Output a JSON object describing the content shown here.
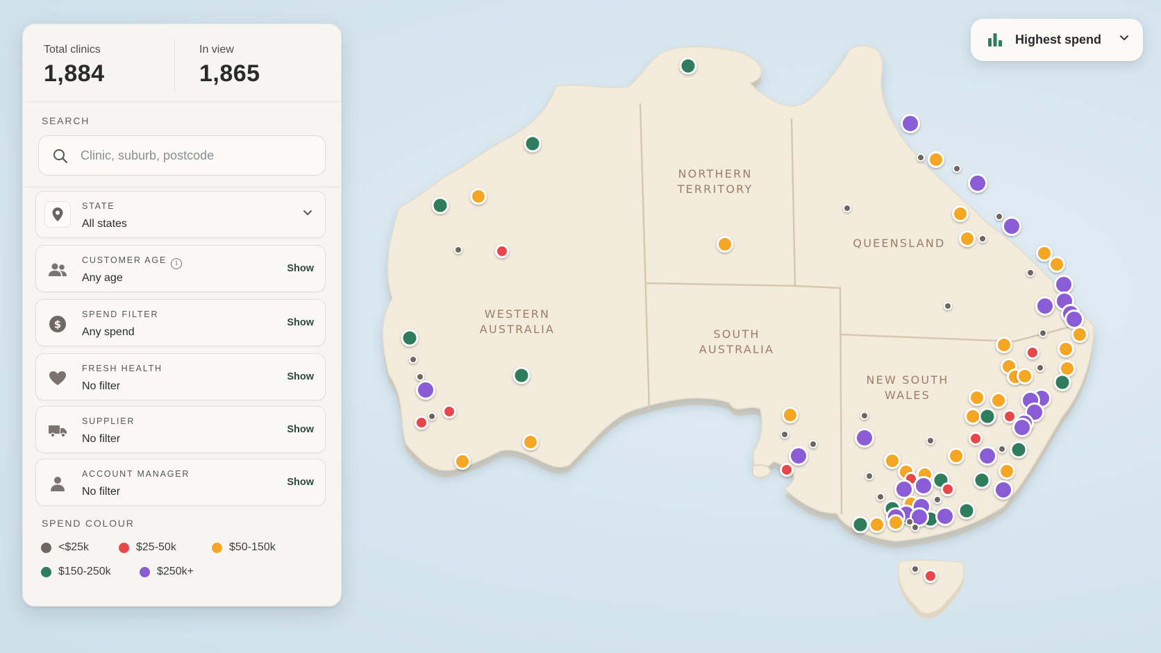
{
  "stats": {
    "total_label": "Total clinics",
    "total_value": "1,884",
    "inview_label": "In view",
    "inview_value": "1,865"
  },
  "search": {
    "section_label": "SEARCH",
    "placeholder": "Clinic, suburb, postcode"
  },
  "filters": [
    {
      "title": "STATE",
      "value": "All states",
      "action": "",
      "icon": "location-pin-icon"
    },
    {
      "title": "CUSTOMER AGE",
      "value": "Any age",
      "action": "Show",
      "icon": "people-icon"
    },
    {
      "title": "SPEND FILTER",
      "value": "Any spend",
      "action": "Show",
      "icon": "dollar-icon"
    },
    {
      "title": "FRESH HEALTH",
      "value": "No filter",
      "action": "Show",
      "icon": "heart-icon"
    },
    {
      "title": "SUPPLIER",
      "value": "No filter",
      "action": "Show",
      "icon": "truck-icon"
    },
    {
      "title": "ACCOUNT MANAGER",
      "value": "No filter",
      "action": "Show",
      "icon": "person-icon"
    }
  ],
  "legend": {
    "title": "SPEND COLOUR",
    "items": [
      {
        "label": "<$25k",
        "color": "#6e6660"
      },
      {
        "label": "$25-50k",
        "color": "#e8474a"
      },
      {
        "label": "$50-150k",
        "color": "#f5a623"
      },
      {
        "label": "$150-250k",
        "color": "#2e7d5b"
      },
      {
        "label": "$250k+",
        "color": "#8a5cd6"
      }
    ]
  },
  "sort": {
    "label": "Highest spend",
    "icon": "bar-chart-icon",
    "accent": "#2e7d5b"
  },
  "map": {
    "state_labels": [
      [
        "WESTERN",
        "AUSTRALIA"
      ],
      [
        "NORTHERN",
        "TERRITORY"
      ],
      [
        "QUEENSLAND"
      ],
      [
        "SOUTH",
        "AUSTRALIA"
      ],
      [
        "NEW SOUTH",
        "WALES"
      ]
    ],
    "land_color": "#f3ebdc",
    "border_color": "#d6c7b0"
  }
}
